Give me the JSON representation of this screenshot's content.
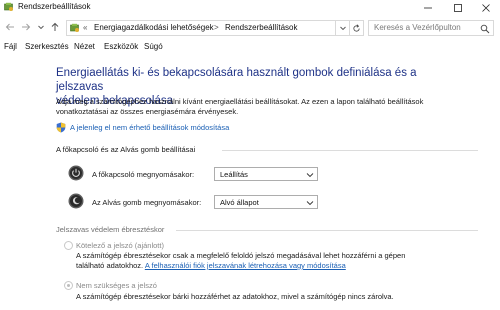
{
  "window": {
    "title": "Rendszerbeállítások",
    "min_symbol": "—",
    "max_symbol": "☐",
    "close_symbol": "✕"
  },
  "nav": {
    "back_icon": "back-arrow-icon",
    "forward_icon": "forward-arrow-icon",
    "recent_icon": "chevron-down-icon",
    "up_icon": "up-arrow-icon",
    "breadcrumb_lead": "«",
    "crumb1": "Energiagazdálkodási lehetőségek",
    "crumb_sep": ">",
    "crumb2": "Rendszerbeállítások",
    "search_placeholder": "Keresés a Vezérlőpulton"
  },
  "menu": {
    "file": "Fájl",
    "edit": "Szerkesztés",
    "view": "Nézet",
    "tools": "Eszközök",
    "help": "Súgó"
  },
  "content": {
    "heading_line1": "Energiaellátás ki- és bekapcsolására használt gombok definiálása és a jelszavas",
    "heading_line2": "védelem bekapcsolása",
    "desc_line1": "Adja meg a számítógéphez használni kívánt energiaellátási beállításokat. Az ezen a lapon található beállítások",
    "desc_line2": "vonatkoztatásai az összes energiasémára érvényesek.",
    "change_link": "A jelenleg el nem érhető beállítások módosítása",
    "buttons_section": "A főkapcsoló és az Alvás gomb beállításai",
    "power_label": "A főkapcsoló megnyomásakor:",
    "power_value": "Leállítás",
    "sleep_label": "Az Alvás gomb megnyomásakor:",
    "sleep_value": "Alvó állapot",
    "password_section": "Jelszavas védelem ébresztéskor",
    "radio1_label": "Kötelező a jelszó (ajánlott)",
    "radio1_desc1": "A számítógép ébresztésekor csak a megfelelő feloldó jelszó megadásával lehet hozzáférni a gépen",
    "radio1_desc2_pre": "található adatokhoz. ",
    "radio1_desc2_link": "A felhasználói fiók jelszavának létrehozása vagy módosítása",
    "radio2_label": "Nem szükséges a jelszó",
    "radio2_desc": "A számítógép ébresztésekor bárki hozzáférhet az adatokhoz, mivel a számítógép nincs zárolva."
  },
  "colors": {
    "heading": "#1e3287",
    "link": "#1a5fb4"
  }
}
